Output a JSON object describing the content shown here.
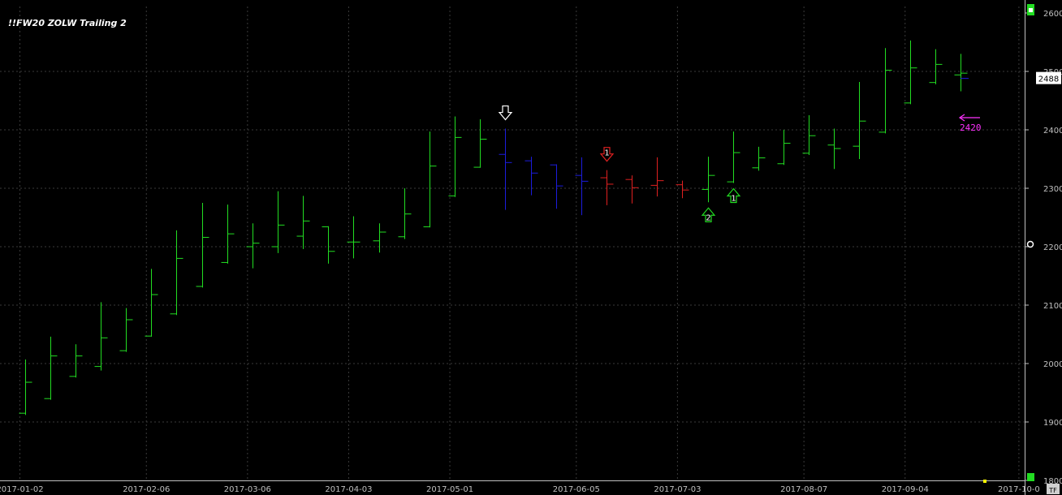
{
  "window": {
    "title": "!!FW20 ZOLW Trailing 2"
  },
  "colors": {
    "background": "#000000",
    "grid": "#3a3a3a",
    "axis": "#c0c0c0",
    "up_bar": "#22dd22",
    "down_bar": "#1c1cdd",
    "red_bar": "#e02020",
    "arrow_green": "#22dd22",
    "arrow_red": "#e02020",
    "arrow_white": "#ffffff",
    "target": "#ff33ff",
    "last_price_box": "#ffffff"
  },
  "chart_data": {
    "type": "ohlc",
    "title": "!!FW20 ZOLW Trailing 2",
    "x_tick_labels": [
      "2017-01-02",
      "2017-02-06",
      "2017-03-06",
      "2017-04-03",
      "2017-05-01",
      "2017-06-05",
      "2017-07-03",
      "2017-08-07",
      "2017-09-04",
      "2017-10-0"
    ],
    "x_tick_bar_index": [
      0,
      5,
      9,
      13,
      17,
      22,
      26,
      31,
      35,
      39.5
    ],
    "y_ticks": [
      1800,
      1900,
      2000,
      2100,
      2200,
      2300,
      2400,
      2500,
      2600
    ],
    "y_tick_labels": [
      "1800",
      "1900",
      "2000",
      "2100",
      "2200",
      "2300",
      "2400",
      "2500",
      "2600"
    ],
    "ylim": [
      1800,
      2600
    ],
    "grid": true,
    "last_price": {
      "value": 2488,
      "label": "2488"
    },
    "target": {
      "value": 2400,
      "label": "2420"
    },
    "bars": [
      {
        "o": 1915,
        "h": 2007,
        "l": 1912,
        "c": 1968,
        "color": "up"
      },
      {
        "o": 1940,
        "h": 2046,
        "l": 1938,
        "c": 2013,
        "color": "up"
      },
      {
        "o": 1978,
        "h": 2033,
        "l": 1976,
        "c": 2013,
        "color": "up"
      },
      {
        "o": 1995,
        "h": 2105,
        "l": 1988,
        "c": 2044,
        "color": "up"
      },
      {
        "o": 2022,
        "h": 2095,
        "l": 2020,
        "c": 2075,
        "color": "up"
      },
      {
        "o": 2047,
        "h": 2162,
        "l": 2046,
        "c": 2118,
        "color": "up"
      },
      {
        "o": 2085,
        "h": 2228,
        "l": 2083,
        "c": 2180,
        "color": "up"
      },
      {
        "o": 2132,
        "h": 2275,
        "l": 2130,
        "c": 2216,
        "color": "up"
      },
      {
        "o": 2173,
        "h": 2272,
        "l": 2171,
        "c": 2222,
        "color": "up"
      },
      {
        "o": 2200,
        "h": 2240,
        "l": 2163,
        "c": 2206,
        "color": "up"
      },
      {
        "o": 2200,
        "h": 2295,
        "l": 2189,
        "c": 2237,
        "color": "up"
      },
      {
        "o": 2218,
        "h": 2287,
        "l": 2196,
        "c": 2244,
        "color": "up"
      },
      {
        "o": 2234,
        "h": 2235,
        "l": 2171,
        "c": 2192,
        "color": "up"
      },
      {
        "o": 2208,
        "h": 2252,
        "l": 2180,
        "c": 2208,
        "color": "up"
      },
      {
        "o": 2210,
        "h": 2240,
        "l": 2190,
        "c": 2225,
        "color": "up"
      },
      {
        "o": 2217,
        "h": 2300,
        "l": 2213,
        "c": 2256,
        "color": "up"
      },
      {
        "o": 2234,
        "h": 2397,
        "l": 2233,
        "c": 2338,
        "color": "up"
      },
      {
        "o": 2287,
        "h": 2423,
        "l": 2285,
        "c": 2387,
        "color": "up"
      },
      {
        "o": 2336,
        "h": 2418,
        "l": 2335,
        "c": 2384,
        "color": "up"
      },
      {
        "o": 2358,
        "h": 2402,
        "l": 2263,
        "c": 2344,
        "color": "down"
      },
      {
        "o": 2347,
        "h": 2354,
        "l": 2288,
        "c": 2326,
        "color": "down"
      },
      {
        "o": 2340,
        "h": 2341,
        "l": 2265,
        "c": 2304,
        "color": "down"
      },
      {
        "o": 2322,
        "h": 2353,
        "l": 2254,
        "c": 2312,
        "color": "down"
      },
      {
        "o": 2318,
        "h": 2331,
        "l": 2271,
        "c": 2307,
        "color": "red"
      },
      {
        "o": 2315,
        "h": 2322,
        "l": 2274,
        "c": 2301,
        "color": "red"
      },
      {
        "o": 2305,
        "h": 2353,
        "l": 2286,
        "c": 2313,
        "color": "red"
      },
      {
        "o": 2306,
        "h": 2313,
        "l": 2283,
        "c": 2297,
        "color": "red"
      },
      {
        "o": 2298,
        "h": 2354,
        "l": 2276,
        "c": 2322,
        "color": "up"
      },
      {
        "o": 2311,
        "h": 2397,
        "l": 2309,
        "c": 2361,
        "color": "up"
      },
      {
        "o": 2335,
        "h": 2371,
        "l": 2330,
        "c": 2352,
        "color": "up"
      },
      {
        "o": 2342,
        "h": 2400,
        "l": 2340,
        "c": 2377,
        "color": "up"
      },
      {
        "o": 2360,
        "h": 2425,
        "l": 2357,
        "c": 2390,
        "color": "up"
      },
      {
        "o": 2374,
        "h": 2402,
        "l": 2333,
        "c": 2368,
        "color": "up"
      },
      {
        "o": 2372,
        "h": 2482,
        "l": 2350,
        "c": 2415,
        "color": "up"
      },
      {
        "o": 2396,
        "h": 2540,
        "l": 2394,
        "c": 2502,
        "color": "up"
      },
      {
        "o": 2446,
        "h": 2553,
        "l": 2444,
        "c": 2506,
        "color": "up"
      },
      {
        "o": 2481,
        "h": 2538,
        "l": 2478,
        "c": 2512,
        "color": "up"
      },
      {
        "o": 2494,
        "h": 2530,
        "l": 2466,
        "c": 2497,
        "color": "up"
      }
    ],
    "markers": [
      {
        "bar": 19,
        "y": 2402,
        "dir": "down",
        "color": "white",
        "label": ""
      },
      {
        "bar": 23,
        "y": 2331,
        "dir": "down",
        "color": "red",
        "label": "1"
      },
      {
        "bar": 27,
        "y": 2276,
        "dir": "up",
        "color": "green",
        "label": "2"
      },
      {
        "bar": 28,
        "y": 2309,
        "dir": "up",
        "color": "green",
        "label": "1"
      }
    ]
  }
}
